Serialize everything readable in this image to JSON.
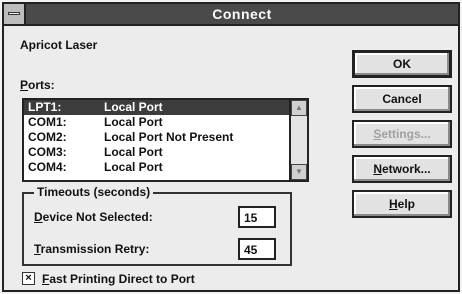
{
  "window": {
    "title": "Connect"
  },
  "printer_name": "Apricot Laser",
  "ports_label_accel": "P",
  "ports_label_rest": "orts:",
  "ports": [
    {
      "port": "LPT1:",
      "desc": "Local Port",
      "selected": true
    },
    {
      "port": "COM1:",
      "desc": "Local Port",
      "selected": false
    },
    {
      "port": "COM2:",
      "desc": "Local Port Not Present",
      "selected": false
    },
    {
      "port": "COM3:",
      "desc": "Local Port",
      "selected": false
    },
    {
      "port": "COM4:",
      "desc": "Local Port",
      "selected": false
    }
  ],
  "timeouts": {
    "title": "Timeouts (seconds)",
    "device_label_accel": "D",
    "device_label_rest": "evice Not Selected:",
    "device_value": "15",
    "retry_label_accel": "T",
    "retry_label_rest": "ransmission Retry:",
    "retry_value": "45"
  },
  "fast_printing": {
    "label_accel": "F",
    "label_rest": "ast Printing Direct to Port",
    "checked": true,
    "mark": "×"
  },
  "buttons": {
    "ok": "OK",
    "cancel": "Cancel",
    "settings_accel": "S",
    "settings_rest": "ettings...",
    "network_accel": "N",
    "network_rest": "etwork...",
    "help_accel": "H",
    "help_rest": "elp"
  },
  "scroll_up": "▲",
  "scroll_down": "▼"
}
